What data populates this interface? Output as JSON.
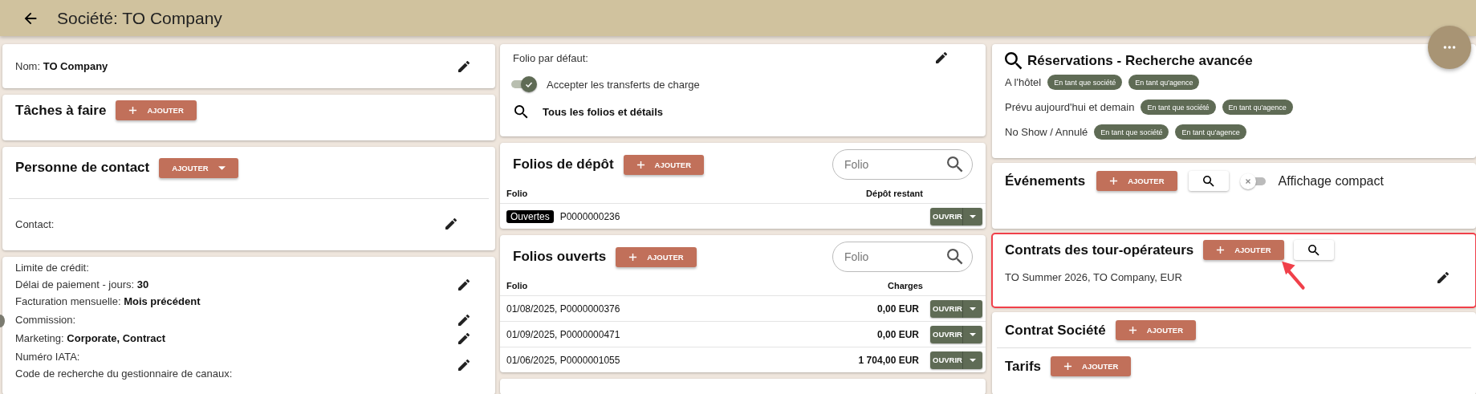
{
  "header": {
    "title": "Société: TO Company"
  },
  "company_name": {
    "label": "Nom:",
    "value": "TO Company"
  },
  "tasks": {
    "title": "Tâches à faire",
    "add_button": "AJOUTER"
  },
  "contacts": {
    "title": "Personne de contact",
    "add_button": "AJOUTER",
    "fields": [
      {
        "label": "Contact:"
      }
    ]
  },
  "billing": {
    "groups": [
      {
        "lines": [
          {
            "label": "Limite de crédit:"
          },
          {
            "label": "Délai de paiement - jours:",
            "value": "30"
          },
          {
            "label": "Facturation mensuelle:",
            "value": "Mois précédent"
          }
        ]
      },
      {
        "lines": [
          {
            "label": "Commission:"
          }
        ]
      },
      {
        "lines": [
          {
            "label": "Marketing:",
            "value": "Corporate, Contract"
          }
        ]
      },
      {
        "lines": [
          {
            "label": "Numéro IATA:"
          },
          {
            "label": "Code de recherche du gestionnaire de canaux:"
          }
        ]
      }
    ]
  },
  "folio_settings": {
    "default_folio_label": "Folio par défaut:",
    "accept_transfers": {
      "label": "Accepter les transferts de charge",
      "on": true
    },
    "all_folios_link": "Tous les folios et détails"
  },
  "deposit_folios": {
    "title": "Folios de dépôt",
    "add_button": "AJOUTER",
    "search_placeholder": "Folio",
    "columns": [
      "Folio",
      "Dépôt restant"
    ],
    "rows": [
      {
        "badge": "Ouvertes",
        "folio": "P0000000236",
        "open_button": "OUVRIR"
      }
    ]
  },
  "open_folios": {
    "title": "Folios ouverts",
    "add_button": "AJOUTER",
    "search_placeholder": "Folio",
    "columns": [
      "Folio",
      "Charges"
    ],
    "rows": [
      {
        "folio": "01/08/2025, P0000000376",
        "amount": "0,00 EUR",
        "open_button": "OUVRIR"
      },
      {
        "folio": "01/09/2025, P0000000471",
        "amount": "0,00 EUR",
        "open_button": "OUVRIR"
      },
      {
        "folio": "01/06/2025, P0000001055",
        "amount": "1 704,00 EUR",
        "open_button": "OUVRIR"
      }
    ]
  },
  "reservations": {
    "title": "Réservations - Recherche avancée",
    "rows": [
      {
        "label": "A l'hôtel",
        "chips": [
          "En tant que société",
          "En tant qu'agence"
        ]
      },
      {
        "label": "Prévu aujourd'hui et demain",
        "chips": [
          "En tant que société",
          "En tant qu'agence"
        ]
      },
      {
        "label": "No Show / Annulé",
        "chips": [
          "En tant que société",
          "En tant qu'agence"
        ]
      }
    ]
  },
  "events": {
    "title": "Événements",
    "add_button": "AJOUTER",
    "compact_toggle": {
      "label": "Affichage compact",
      "on": false
    },
    "highlighted": false
  },
  "to_contracts": {
    "title": "Contrats des tour-opérateurs",
    "add_button": "AJOUTER",
    "items": [
      "TO Summer 2026, TO Company, EUR"
    ],
    "highlighted": true
  },
  "company_contract": {
    "title": "Contrat Société",
    "add_button": "AJOUTER"
  },
  "rates": {
    "title": "Tarifs",
    "add_button": "AJOUTER"
  }
}
